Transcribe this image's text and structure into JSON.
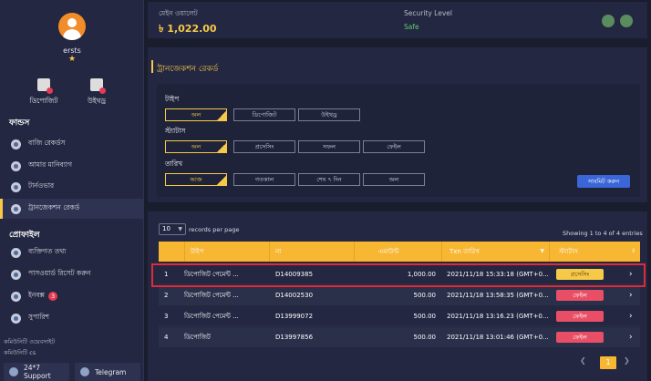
{
  "sidebar": {
    "username": "ersts",
    "star": "★",
    "quick": [
      {
        "label": "ডিপোজিট",
        "icon": "deposit-icon"
      },
      {
        "label": "উইথড্র",
        "icon": "withdraw-icon"
      }
    ],
    "funds_title": "ফান্ডস",
    "funds_items": [
      {
        "label": "বাজি রেকর্ডস",
        "icon": "bet-records-icon"
      },
      {
        "label": "আমার মানিব্যাগ",
        "icon": "wallet-icon"
      },
      {
        "label": "টার্নওভার",
        "icon": "turnover-icon"
      },
      {
        "label": "ট্রানজেকশন রেকর্ড",
        "icon": "transaction-records-icon"
      }
    ],
    "profile_title": "প্রোফাইল",
    "profile_items": [
      {
        "label": "ব্যক্তিগত তথ্য",
        "icon": "personal-info-icon"
      },
      {
        "label": "পাসওয়ার্ড রিসেট করুন",
        "icon": "password-reset-icon"
      },
      {
        "label": "ইনবক্স",
        "icon": "inbox-icon",
        "badge": "3"
      },
      {
        "label": "সুপারিশ",
        "icon": "referral-icon"
      }
    ],
    "community_1": "কমিউনিটি ওয়েবসাইট",
    "community_2": "কমিউনিটি cs",
    "support_label": "24*7 Support",
    "telegram_label": "Telegram"
  },
  "wallet": {
    "label": "মেইন ওয়ালেট",
    "value": "৳ 1,022.00",
    "security_label": "Security Level",
    "security_value": "Safe"
  },
  "filter": {
    "title": "ট্রানজেকশন রেকর্ড",
    "type_label": "টাইপ",
    "type_options": [
      "অল",
      "ডিপোজিট",
      "উইথড্র"
    ],
    "status_label": "স্ট্যাটাস",
    "status_options": [
      "অল",
      "প্রসেসিং",
      "সফল",
      "ফেইল"
    ],
    "date_label": "তারিখ",
    "date_options": [
      "আজ",
      "গতকাল",
      "শেষ ৭ দিন",
      "অল"
    ],
    "submit_label": "সাবমিট করুন",
    "selected_color": "#f7c948"
  },
  "table": {
    "per_page_value": "10",
    "per_page_label": "records per page",
    "showing": "Showing 1 to 4 of 4 entries",
    "headers": [
      "টাইপ",
      "না",
      "এমাউন্ট",
      "Txn তারিখ",
      "স্ট্যাটাস"
    ],
    "rows": [
      {
        "no": "1",
        "type": "ডিপোজিট পেমেন্ট ...",
        "ref": "D14009385",
        "amount": "1,000.00",
        "date": "2021/11/18 15:33:18 (GMT+0...",
        "status": "প্রসেসিং",
        "status_kind": "processing"
      },
      {
        "no": "2",
        "type": "ডিপোজিট পেমেন্ট ...",
        "ref": "D14002530",
        "amount": "500.00",
        "date": "2021/11/18 13:58:35 (GMT+0...",
        "status": "ফেইল",
        "status_kind": "failed"
      },
      {
        "no": "3",
        "type": "ডিপোজিট পেমেন্ট ...",
        "ref": "D13999072",
        "amount": "500.00",
        "date": "2021/11/18 13:16.23 (GMT+0...",
        "status": "ফেইল",
        "status_kind": "failed"
      },
      {
        "no": "4",
        "type": "ডিপোজিট",
        "ref": "D13997856",
        "amount": "500.00",
        "date": "2021/11/18 13:01:46 (GMT+0...",
        "status": "ফেইল",
        "status_kind": "failed"
      }
    ],
    "header_color": "#f7b733",
    "page": "1"
  }
}
